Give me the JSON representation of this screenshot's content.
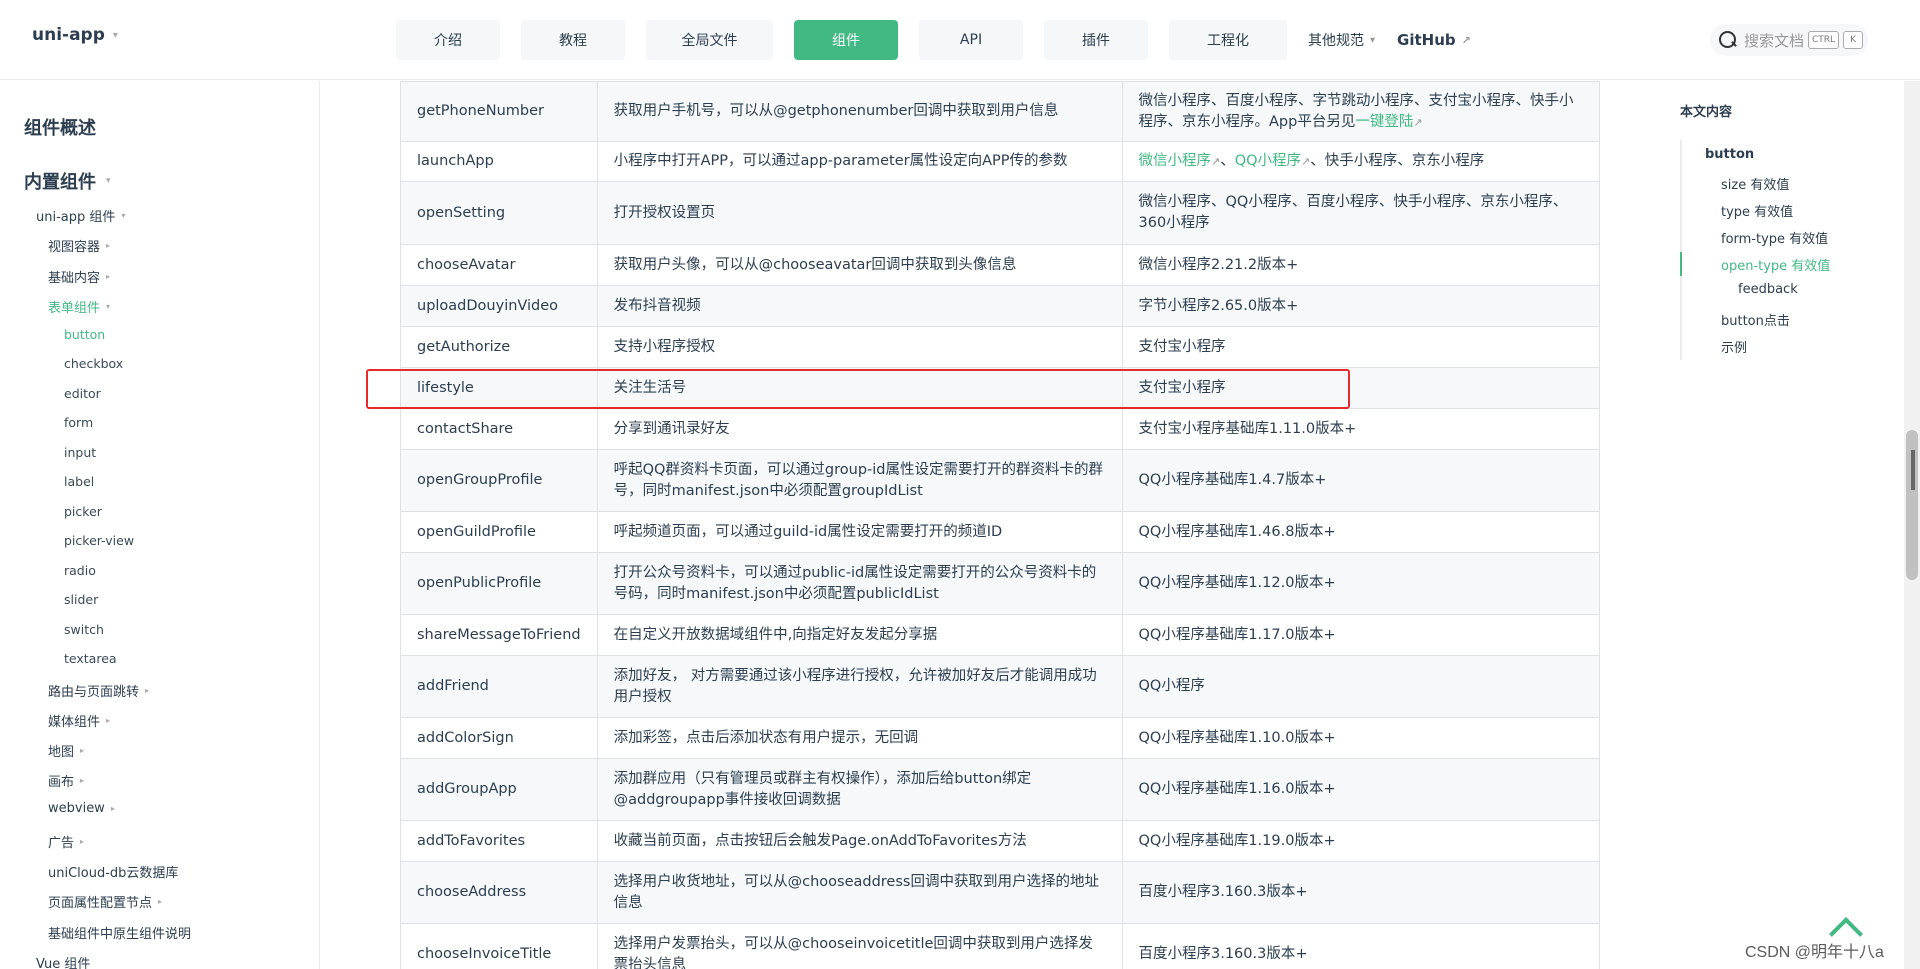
{
  "header": {
    "brand": "uni-app",
    "nav": [
      {
        "label": "介绍",
        "active": false
      },
      {
        "label": "教程",
        "active": false
      },
      {
        "label": "全局文件",
        "active": false
      },
      {
        "label": "组件",
        "active": true
      },
      {
        "label": "API",
        "active": false
      },
      {
        "label": "插件",
        "active": false
      },
      {
        "label": "工程化",
        "active": false
      }
    ],
    "more": "其他规范",
    "github": "GitHub",
    "search": {
      "placeholder": "搜索文档",
      "key1": "CTRL",
      "key2": "K"
    }
  },
  "sidebar": {
    "overview": "组件概述",
    "builtin": "内置组件",
    "uniapp_components": "uni-app 组件",
    "view_container": "视图容器",
    "basic_content": "基础内容",
    "form_components": "表单组件",
    "form_items": [
      "button",
      "checkbox",
      "editor",
      "form",
      "input",
      "label",
      "picker",
      "picker-view",
      "radio",
      "slider",
      "switch",
      "textarea"
    ],
    "after": [
      "路由与页面跳转",
      "媒体组件",
      "地图",
      "画布",
      "webview",
      "广告",
      "uniCloud-db云数据库",
      "页面属性配置节点",
      "基础组件中原生组件说明",
      "Vue 组件"
    ]
  },
  "table": {
    "rows": [
      {
        "name": "getPhoneNumber",
        "desc": "获取用户手机号，可以从@getphonenumber回调中获取到用户信息",
        "platform": "微信小程序、百度小程序、字节跳动小程序、支付宝小程序、快手小程序、京东小程序。App平台另见",
        "platform_link": "一键登陆"
      },
      {
        "name": "launchApp",
        "desc": "小程序中打开APP，可以通过app-parameter属性设定向APP传的参数",
        "platform_link1": "微信小程序",
        "platform_sep": "、",
        "platform_link2": "QQ小程序",
        "platform": "、快手小程序、京东小程序"
      },
      {
        "name": "openSetting",
        "desc": "打开授权设置页",
        "platform": "微信小程序、QQ小程序、百度小程序、快手小程序、京东小程序、360小程序"
      },
      {
        "name": "chooseAvatar",
        "desc": "获取用户头像，可以从@chooseavatar回调中获取到头像信息",
        "platform": "微信小程序2.21.2版本+"
      },
      {
        "name": "uploadDouyinVideo",
        "desc": "发布抖音视频",
        "platform": "字节小程序2.65.0版本+"
      },
      {
        "name": "getAuthorize",
        "desc": "支持小程序授权",
        "platform": "支付宝小程序"
      },
      {
        "name": "lifestyle",
        "desc": "关注生活号",
        "platform": "支付宝小程序"
      },
      {
        "name": "contactShare",
        "desc": "分享到通讯录好友",
        "platform": "支付宝小程序基础库1.11.0版本+"
      },
      {
        "name": "openGroupProfile",
        "desc": "呼起QQ群资料卡页面，可以通过group-id属性设定需要打开的群资料卡的群号，同时manifest.json中必须配置groupIdList",
        "platform": "QQ小程序基础库1.4.7版本+"
      },
      {
        "name": "openGuildProfile",
        "desc": "呼起频道页面，可以通过guild-id属性设定需要打开的频道ID",
        "platform": "QQ小程序基础库1.46.8版本+"
      },
      {
        "name": "openPublicProfile",
        "desc": "打开公众号资料卡，可以通过public-id属性设定需要打开的公众号资料卡的号码，同时manifest.json中必须配置publicIdList",
        "platform": "QQ小程序基础库1.12.0版本+"
      },
      {
        "name": "shareMessageToFriend",
        "desc": "在自定义开放数据域组件中,向指定好友发起分享据",
        "platform": "QQ小程序基础库1.17.0版本+"
      },
      {
        "name": "addFriend",
        "desc": "添加好友， 对方需要通过该小程序进行授权，允许被加好友后才能调用成功用户授权",
        "platform": "QQ小程序"
      },
      {
        "name": "addColorSign",
        "desc": "添加彩签，点击后添加状态有用户提示，无回调",
        "platform": "QQ小程序基础库1.10.0版本+"
      },
      {
        "name": "addGroupApp",
        "desc": "添加群应用（只有管理员或群主有权操作），添加后给button绑定@addgroupapp事件接收回调数据",
        "platform": "QQ小程序基础库1.16.0版本+"
      },
      {
        "name": "addToFavorites",
        "desc": "收藏当前页面，点击按钮后会触发Page.onAddToFavorites方法",
        "platform": "QQ小程序基础库1.19.0版本+"
      },
      {
        "name": "chooseAddress",
        "desc": "选择用户收货地址，可以从@chooseaddress回调中获取到用户选择的地址信息",
        "platform": "百度小程序3.160.3版本+"
      },
      {
        "name": "chooseInvoiceTitle",
        "desc": "选择用户发票抬头，可以从@chooseinvoicetitle回调中获取到用户选择发票抬头信息",
        "platform": "百度小程序3.160.3版本+"
      }
    ]
  },
  "toc": {
    "title": "本文内容",
    "items": [
      "button",
      "size 有效值",
      "type 有效值",
      "form-type 有效值",
      "open-type 有效值",
      "feedback",
      "button点击",
      "示例"
    ],
    "active_index": 4
  },
  "watermark": "CSDN @明年十八a",
  "colors": {
    "accent": "#42b983",
    "highlight": "#e32b2b"
  }
}
